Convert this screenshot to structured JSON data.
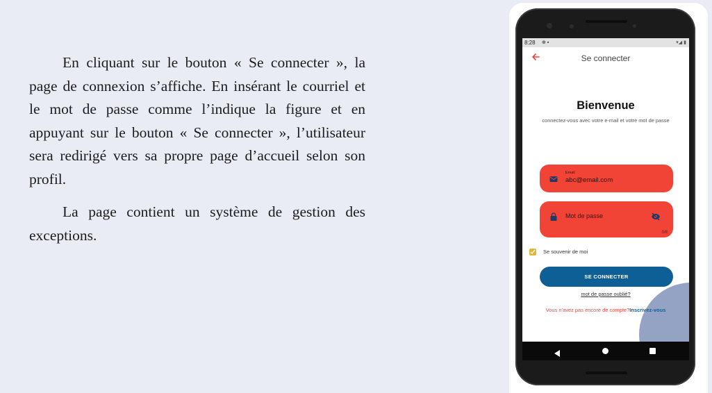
{
  "document": {
    "paragraph1": "En cliquant sur le bouton « Se connecter », la page de connexion s’affiche. En insérant le courriel et le mot de passe comme l’indique la figure et en appuyant sur le bouton « Se connecter », l’utilisateur sera redirigé vers sa propre page d’accueil selon son profil.",
    "paragraph2": "La page contient un système de gestion des exceptions."
  },
  "phone": {
    "status_bar": {
      "time": "8:28",
      "left_icons": "⊕ ▪",
      "right_icons": "▾◢ ▮"
    },
    "app_bar": {
      "title": "Se connecter",
      "back_icon": "arrow-left-icon"
    },
    "welcome_title": "Bienvenue",
    "subtitle": "connectez-vous avec votre e-mail et votre mot de passe",
    "email_field": {
      "label": "Email",
      "value": "abc@email.com",
      "icon": "mail-icon"
    },
    "password_field": {
      "placeholder": "Mot de passe",
      "counter": "0/8",
      "icon": "lock-icon",
      "toggle_icon": "eye-off-icon"
    },
    "remember_me": {
      "label": "Se souvenir de moi",
      "checked": true
    },
    "login_button": "SE CONNECTER",
    "forgot_password": "mot de passe oublié?",
    "signup": {
      "prompt": "Vous n'avez pas encore de compte?",
      "link": "Inscrivez-vous"
    },
    "colors": {
      "accent_red": "#f24337",
      "primary_blue": "#0e5f96",
      "checkbox_yellow": "#e2b63a",
      "decor_blue": "#94a3c3"
    }
  }
}
